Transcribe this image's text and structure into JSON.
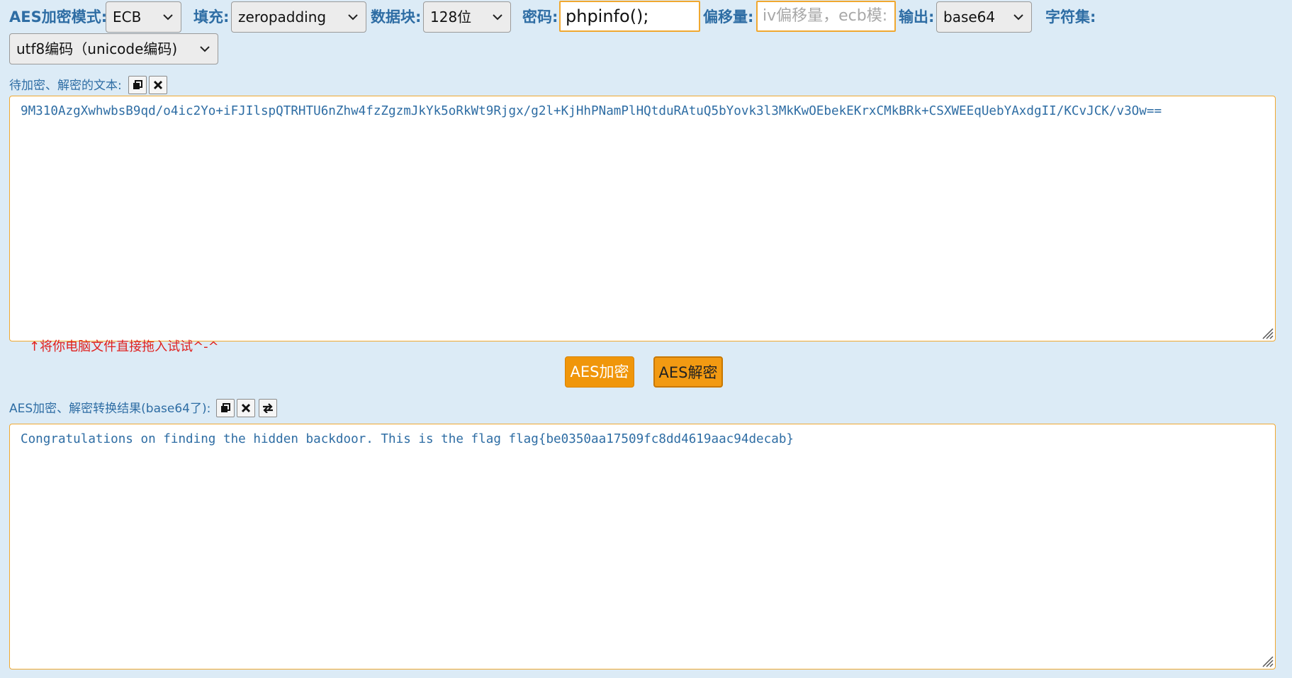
{
  "toolbar": {
    "mode_label": "AES加密模式:",
    "mode_value": "ECB",
    "padding_label": "填充:",
    "padding_value": "zeropadding",
    "block_label": "数据块:",
    "block_value": "128位",
    "password_label": "密码:",
    "password_value": "phpinfo();",
    "iv_label": "偏移量:",
    "iv_placeholder": "iv偏移量，ecb模:",
    "output_label": "输出:",
    "output_value": "base64",
    "charset_label": "字符集:",
    "charset_value": "utf8编码（unicode编码)"
  },
  "input_section": {
    "label": "待加密、解密的文本:",
    "text": "9M310AzgXwhwbsB9qd/o4ic2Yo+iFJIlspQTRHTU6nZhw4fzZgzmJkYk5oRkWt9Rjgx/g2l+KjHhPNamPlHQtduRAtuQ5bYovk3l3MkKwOEbekEKrxCMkBRk+CSXWEEqUebYAxdgII/KCvJCK/v3Ow==",
    "drop_hint": "↑将你电脑文件直接拖入试试^-^"
  },
  "actions": {
    "encrypt_label": "AES加密",
    "decrypt_label": "AES解密"
  },
  "result_section": {
    "label": "AES加密、解密转换结果(base64了):",
    "text": "Congratulations on finding the hidden backdoor. This is the flag flag{be0350aa17509fc8dd4619aac94decab}"
  },
  "colors": {
    "background": "#dcebf6",
    "label_blue": "#2e6da4",
    "border_orange": "#f0a830",
    "button_orange": "#f0960a",
    "hint_red": "#e0201e"
  },
  "icons": [
    "chevron-down-icon",
    "copy-icon",
    "close-icon",
    "swap-icon",
    "resize-grip-icon"
  ]
}
